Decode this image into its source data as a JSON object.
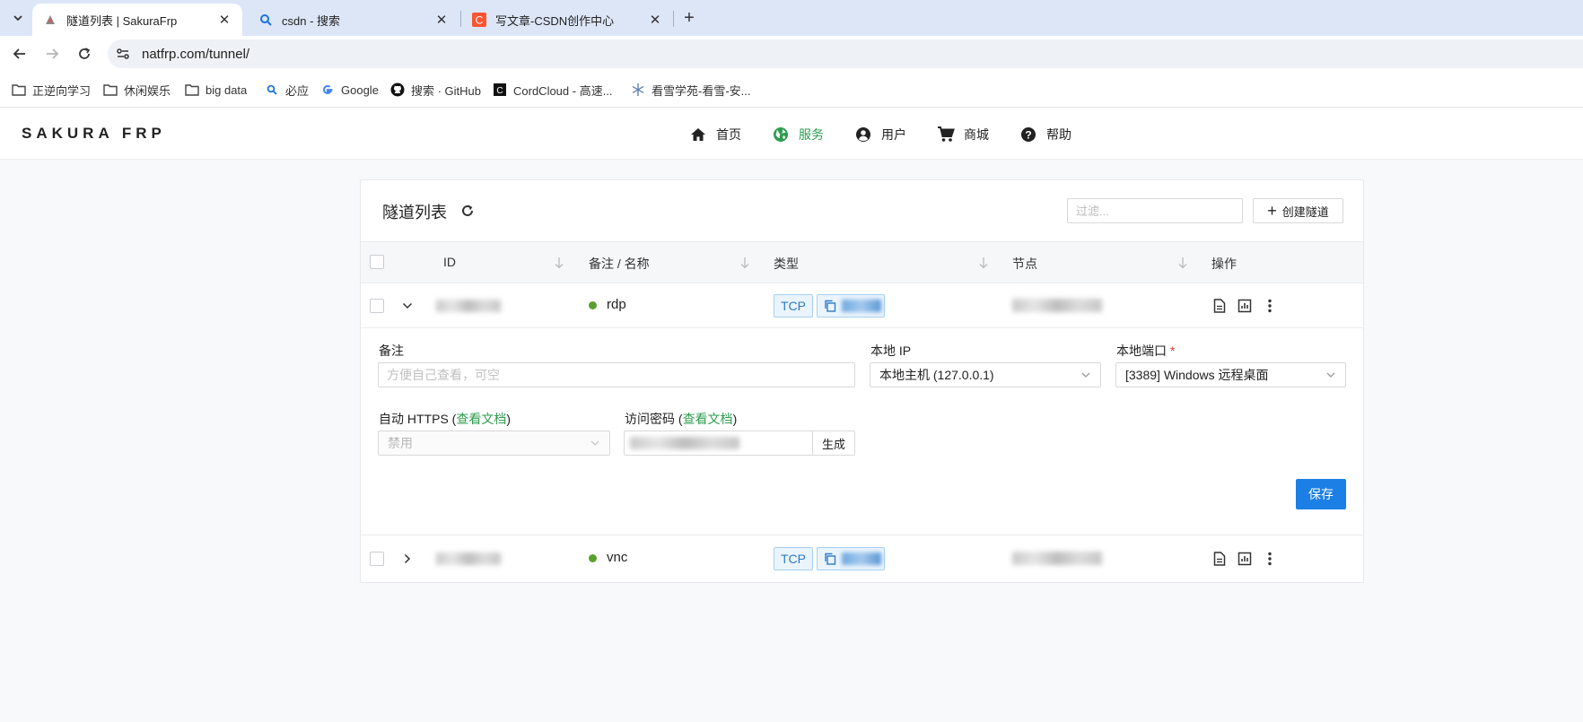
{
  "browser": {
    "tabs": [
      {
        "title": "隧道列表 | SakuraFrp",
        "active": true,
        "favicon": "sakura-favicon-icon"
      },
      {
        "title": "csdn - 搜索",
        "active": false,
        "favicon": "search-favicon-icon"
      },
      {
        "title": "写文章-CSDN创作中心",
        "active": false,
        "favicon": "csdn-favicon-icon"
      }
    ],
    "url": "natfrp.com/tunnel/",
    "bookmarks": [
      {
        "label": "正逆向学习",
        "icon": "folder-icon"
      },
      {
        "label": "休闲娱乐",
        "icon": "folder-icon"
      },
      {
        "label": "big data",
        "icon": "folder-icon"
      },
      {
        "label": "必应",
        "icon": "search-icon"
      },
      {
        "label": "Google",
        "icon": "google-icon"
      },
      {
        "label": "搜索 · GitHub",
        "icon": "github-icon"
      },
      {
        "label": "CordCloud - 高速...",
        "icon": "cordcloud-icon"
      },
      {
        "label": "看雪学苑-看雪-安...",
        "icon": "snowflake-icon"
      }
    ]
  },
  "site": {
    "brand": "SAKURA FRP",
    "nav": [
      {
        "label": "首页",
        "icon": "home-icon",
        "active": false
      },
      {
        "label": "服务",
        "icon": "globe-icon",
        "active": true
      },
      {
        "label": "用户",
        "icon": "user-icon",
        "active": false
      },
      {
        "label": "商城",
        "icon": "cart-icon",
        "active": false
      },
      {
        "label": "帮助",
        "icon": "help-icon",
        "active": false
      }
    ],
    "accent_color": "#2e9c4f",
    "primary_color": "#1b7fe5"
  },
  "tunnels": {
    "title": "隧道列表",
    "filter_placeholder": "过滤...",
    "create_label": "创建隧道",
    "columns": {
      "id": "ID",
      "name": "备注 / 名称",
      "type": "类型",
      "node": "节点",
      "actions": "操作"
    },
    "rows": [
      {
        "name": "rdp",
        "type": "TCP",
        "expanded": true,
        "status_color": "#5aa02c"
      },
      {
        "name": "vnc",
        "type": "TCP",
        "expanded": false,
        "status_color": "#5aa02c"
      }
    ],
    "detail": {
      "note_label": "备注",
      "note_placeholder": "方便自己查看，可空",
      "local_ip_label": "本地 IP",
      "local_ip_value": "本地主机 (127.0.0.1)",
      "local_port_label": "本地端口",
      "local_port_value": "[3389] Windows 远程桌面",
      "auto_https_label": "自动 HTTPS (",
      "auto_https_link": "查看文档",
      "auto_https_value": "禁用",
      "password_label": "访问密码 (",
      "password_link": "查看文档",
      "label_close": ")",
      "generate_label": "生成",
      "save_label": "保存"
    }
  }
}
